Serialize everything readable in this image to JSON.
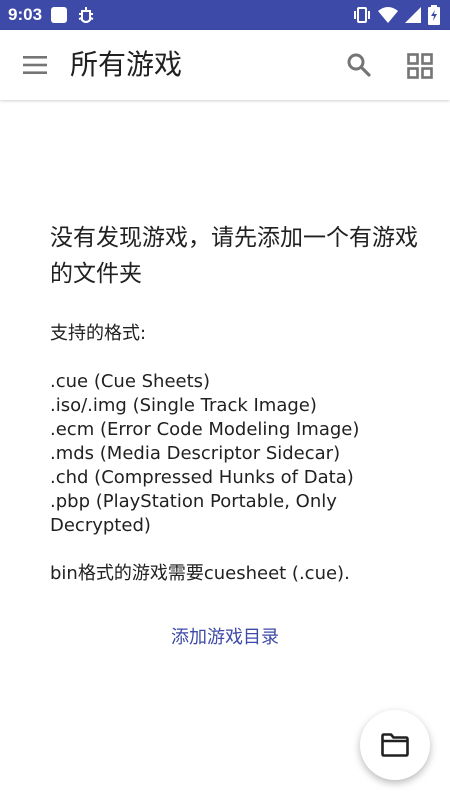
{
  "status_bar": {
    "time": "9:03",
    "icons": [
      "square-app-icon",
      "bug-icon",
      "vibrate-icon",
      "wifi-icon",
      "signal-icon",
      "battery-charging-icon"
    ]
  },
  "app_bar": {
    "title": "所有游戏",
    "icons": [
      "menu-icon",
      "search-icon",
      "grid-view-icon"
    ]
  },
  "empty_state": {
    "headline": "没有发现游戏，请先添加一个有游戏的文件夹",
    "formats_label": "支持的格式:",
    "formats": [
      ".cue (Cue Sheets)",
      ".iso/.img (Single Track Image)",
      ".ecm (Error Code Modeling Image)",
      ".mds (Media Descriptor Sidecar)",
      ".chd (Compressed Hunks of Data)",
      ".pbp (PlayStation Portable, Only Decrypted)"
    ],
    "bin_note": "bin格式的游戏需要cuesheet (.cue).",
    "add_link": "添加游戏目录"
  },
  "fab": {
    "icon": "folder-icon"
  },
  "colors": {
    "primary": "#3e4aa8",
    "text": "#212121",
    "icon": "#757575"
  }
}
